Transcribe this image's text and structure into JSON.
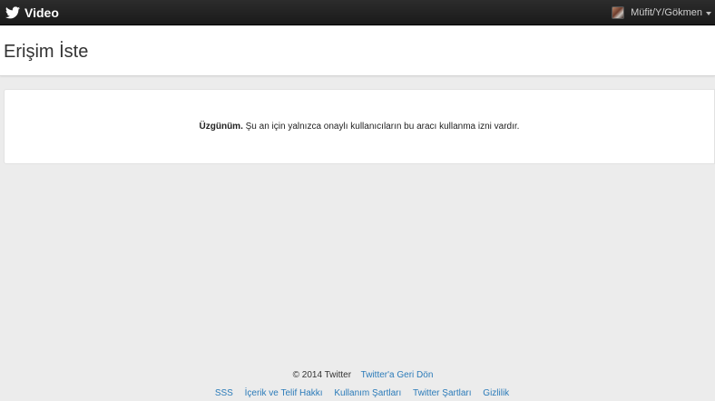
{
  "topbar": {
    "brand_icon": "twitter-bird-icon",
    "brand_label": "Video",
    "user": {
      "avatar_icon": "user-avatar",
      "name": "Müfit/Y/Gökmen",
      "caret_icon": "caret-down-icon"
    },
    "colors": {
      "background": "#1f1f1f",
      "text": "#ffffff"
    }
  },
  "header": {
    "title": "Erişim İste"
  },
  "notice": {
    "bold": "Üzgünüm.",
    "message": " Şu an için yalnızca onaylı kullanıcıların bu aracı kullanma izni vardır."
  },
  "footer": {
    "copyright": "© 2014 Twitter",
    "back_link": "Twitter'a Geri Dön",
    "links": [
      {
        "label": "SSS"
      },
      {
        "label": "İçerik ve Telif Hakkı"
      },
      {
        "label": "Kullanım Şartları"
      },
      {
        "label": "Twitter Şartları"
      },
      {
        "label": "Gizlilik"
      }
    ],
    "link_color": "#2b7bb9"
  }
}
